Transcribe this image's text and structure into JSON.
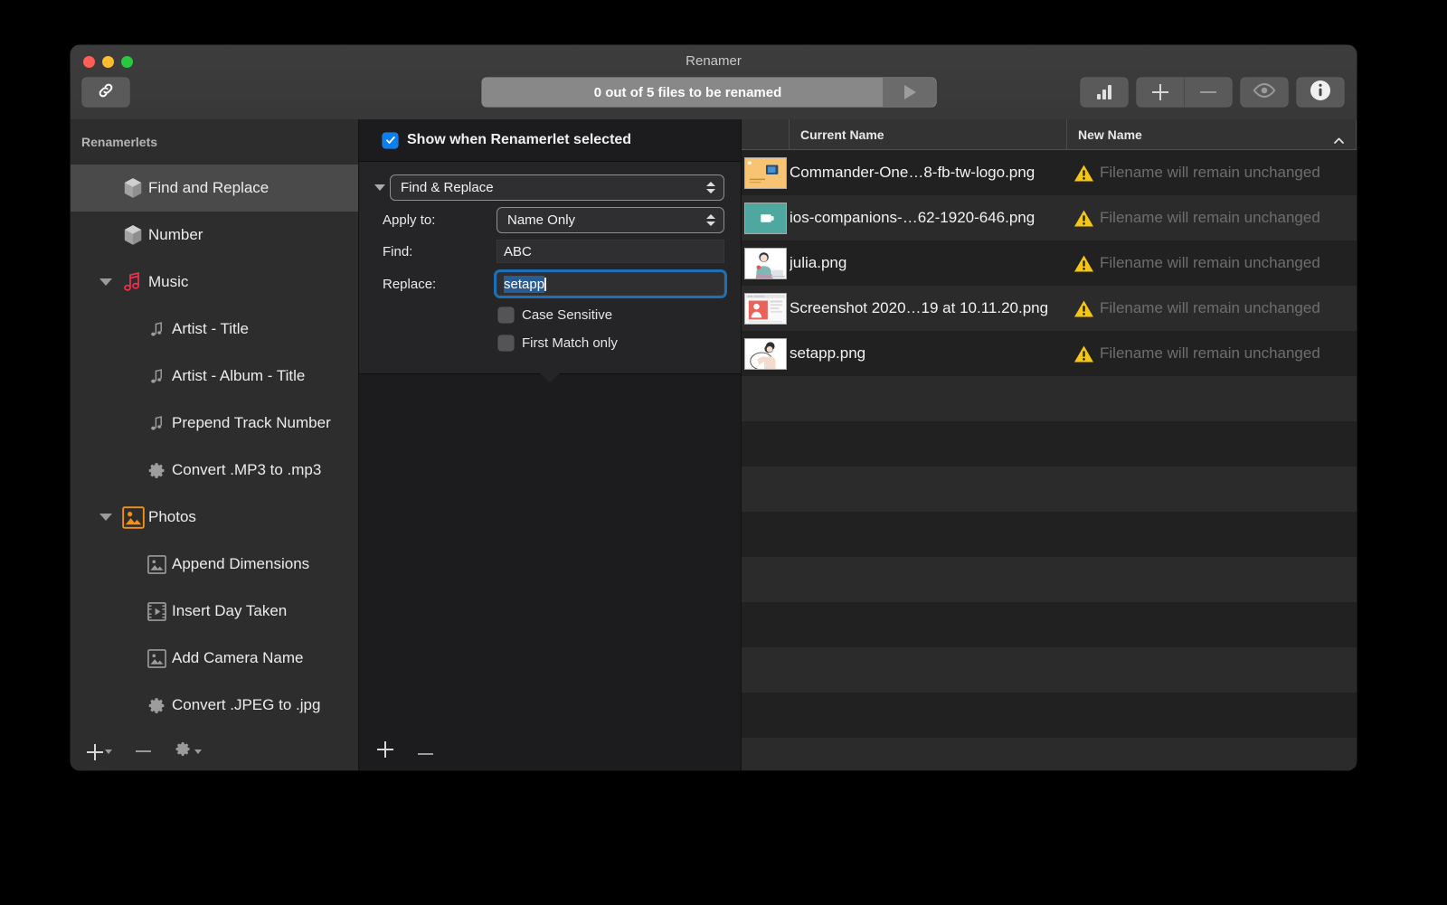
{
  "window": {
    "title": "Renamer",
    "traffic_lights": [
      "close",
      "minimize",
      "zoom"
    ]
  },
  "toolbar": {
    "link_button_icon": "link-icon",
    "rename_status": "0 out of 5 files to be renamed",
    "run_button_icon": "play-triangle-icon",
    "stats_button_icon": "bar-chart-icon",
    "add_button_icon": "plus-icon",
    "remove_button_icon": "minus-icon",
    "preview_button_icon": "eye-icon",
    "info_button_icon": "info-icon"
  },
  "sidebar": {
    "header": "Renamerlets",
    "items": [
      {
        "label": "Find and Replace",
        "icon": "cube-icon",
        "indent": 0,
        "twisty": "",
        "selected": true
      },
      {
        "label": "Number",
        "icon": "cube-icon",
        "indent": 0,
        "twisty": "",
        "selected": false
      },
      {
        "label": "Music",
        "icon": "music-note-icon",
        "indent": 0,
        "twisty": "down",
        "selected": false
      },
      {
        "label": "Artist - Title",
        "icon": "music-file-icon",
        "indent": 1,
        "twisty": "",
        "selected": false
      },
      {
        "label": "Artist - Album - Title",
        "icon": "music-file-icon",
        "indent": 1,
        "twisty": "",
        "selected": false
      },
      {
        "label": "Prepend Track Number",
        "icon": "music-file-icon",
        "indent": 1,
        "twisty": "",
        "selected": false
      },
      {
        "label": "Convert .MP3 to .mp3",
        "icon": "gear-icon",
        "indent": 1,
        "twisty": "",
        "selected": false
      },
      {
        "label": "Photos",
        "icon": "photo-icon",
        "indent": 0,
        "twisty": "down",
        "selected": false
      },
      {
        "label": "Append Dimensions",
        "icon": "image-file-icon",
        "indent": 1,
        "twisty": "",
        "selected": false
      },
      {
        "label": "Insert Day Taken",
        "icon": "film-file-icon",
        "indent": 1,
        "twisty": "",
        "selected": false
      },
      {
        "label": "Add Camera Name",
        "icon": "image-file-icon",
        "indent": 1,
        "twisty": "",
        "selected": false
      },
      {
        "label": "Convert .JPEG to .jpg",
        "icon": "gear-icon",
        "indent": 1,
        "twisty": "",
        "selected": false
      }
    ],
    "footer": {
      "add_icon": "plus-icon",
      "add_menu_icon": "chevron-down-icon",
      "remove_icon": "minus-icon",
      "settings_icon": "gear-icon",
      "settings_menu_icon": "chevron-down-icon"
    }
  },
  "middle": {
    "show_when_selected_label": "Show when Renamerlet selected",
    "show_when_selected_checked": true,
    "action_popup_value": "Find & Replace",
    "apply_to_label": "Apply to:",
    "apply_to_value": "Name Only",
    "find_label": "Find:",
    "find_value": "ABC",
    "replace_label": "Replace:",
    "replace_value": "setapp",
    "replace_focused": true,
    "case_sensitive_label": "Case Sensitive",
    "case_sensitive_checked": false,
    "first_match_label": "First Match only",
    "first_match_checked": false,
    "footer": {
      "add_icon": "plus-icon",
      "remove_icon": "minus-icon"
    }
  },
  "file_list": {
    "columns": [
      "Current Name",
      "New Name"
    ],
    "sort_indicator_icon": "chevron-up-icon",
    "sort_column": "New Name",
    "rows": [
      {
        "thumb": "commander-one-thumb",
        "current_name": "Commander-One…8-fb-tw-logo.png",
        "status_icon": "warning-icon",
        "new_name": "Filename will remain unchanged"
      },
      {
        "thumb": "ios-companions-thumb",
        "current_name": "ios-companions-…62-1920-646.png",
        "status_icon": "warning-icon",
        "new_name": "Filename will remain unchanged"
      },
      {
        "thumb": "julia-thumb",
        "current_name": "julia.png",
        "status_icon": "warning-icon",
        "new_name": "Filename will remain unchanged"
      },
      {
        "thumb": "screenshot-thumb",
        "current_name": "Screenshot 2020…19 at 10.11.20.png",
        "status_icon": "warning-icon",
        "new_name": "Filename will remain unchanged"
      },
      {
        "thumb": "setapp-thumb",
        "current_name": "setapp.png",
        "status_icon": "warning-icon",
        "new_name": "Filename will remain unchanged"
      }
    ],
    "empty_row_count": 9
  },
  "colors": {
    "accent_blue": "#0a7ef5",
    "focus_ring": "#1f6fb5",
    "warning_yellow": "#f5c518",
    "music_red": "#f2314d",
    "photos_orange": "#f59019",
    "selection_blue": "#2a5c94"
  }
}
